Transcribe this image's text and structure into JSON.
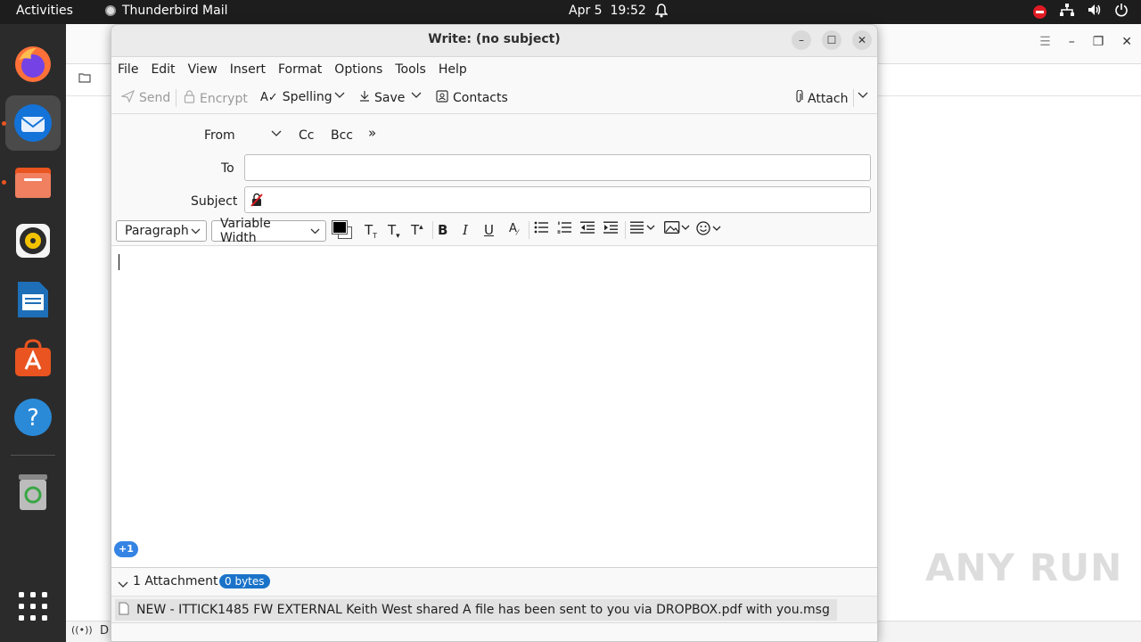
{
  "topbar": {
    "activities": "Activities",
    "app_name": "Thunderbird Mail",
    "date": "Apr 5",
    "time": "19:52"
  },
  "dock": {
    "items": [
      "firefox-icon",
      "thunderbird-icon",
      "files-icon",
      "rhythmbox-icon",
      "writer-icon",
      "software-icon",
      "help-icon",
      "trash-icon",
      "apps-grid-icon"
    ]
  },
  "background_window": {
    "status_initial": "D"
  },
  "compose": {
    "title": "Write: (no subject)",
    "menu": [
      "File",
      "Edit",
      "View",
      "Insert",
      "Format",
      "Options",
      "Tools",
      "Help"
    ],
    "toolbar": {
      "send": "Send",
      "encrypt": "Encrypt",
      "spelling": "Spelling",
      "save": "Save",
      "contacts": "Contacts",
      "attach": "Attach"
    },
    "headers": {
      "from_label": "From",
      "cc": "Cc",
      "bcc": "Bcc",
      "to_label": "To",
      "subject_label": "Subject",
      "to_value": "",
      "subject_value": ""
    },
    "format": {
      "paragraph": "Paragraph",
      "font": "Variable Width",
      "text_color": "#000000"
    },
    "body_badge": "+1",
    "attachments": {
      "header": "1 Attachment",
      "size_badge": "0 bytes",
      "items": [
        "NEW - ITTICK1485 FW EXTERNAL Keith West shared A file has been sent to you via DROPBOX.pdf with you.msg"
      ]
    }
  },
  "watermark": "ANY RUN"
}
